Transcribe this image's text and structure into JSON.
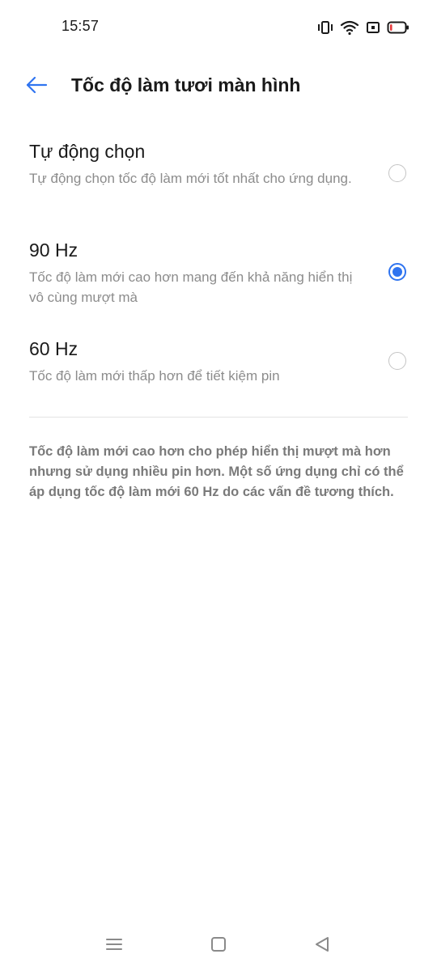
{
  "status_bar": {
    "time": "15:57",
    "icons": [
      "vibrate-icon",
      "wifi-icon",
      "notification-icon",
      "battery-icon"
    ],
    "battery_level_fraction": 0.15,
    "battery_color": "#e5393b"
  },
  "header": {
    "back_icon": "arrow-left-icon",
    "title": "Tốc độ làm tươi màn hình"
  },
  "options": [
    {
      "title": "Tự động chọn",
      "description": "Tự động chọn tốc độ làm mới tốt nhất cho ứng dụng.",
      "selected": false
    },
    {
      "title": "90 Hz",
      "description": "Tốc độ làm mới cao hơn mang đến khả năng hiển thị vô cùng mượt mà",
      "selected": true
    },
    {
      "title": "60 Hz",
      "description": "Tốc độ làm mới thấp hơn để tiết kiệm pin",
      "selected": false
    }
  ],
  "footnote": "Tốc độ làm mới cao hơn cho phép hiển thị mượt mà hơn nhưng sử dụng nhiều pin hơn. Một số ứng dụng chỉ có thể áp dụng tốc độ làm mới 60 Hz do các vấn đề tương thích.",
  "nav_bar": {
    "icons": [
      "menu-icon",
      "home-icon",
      "back-triangle-icon"
    ]
  },
  "colors": {
    "accent": "#2f74f0",
    "text_primary": "#1a1a1a",
    "text_secondary": "#8c8c8c"
  }
}
